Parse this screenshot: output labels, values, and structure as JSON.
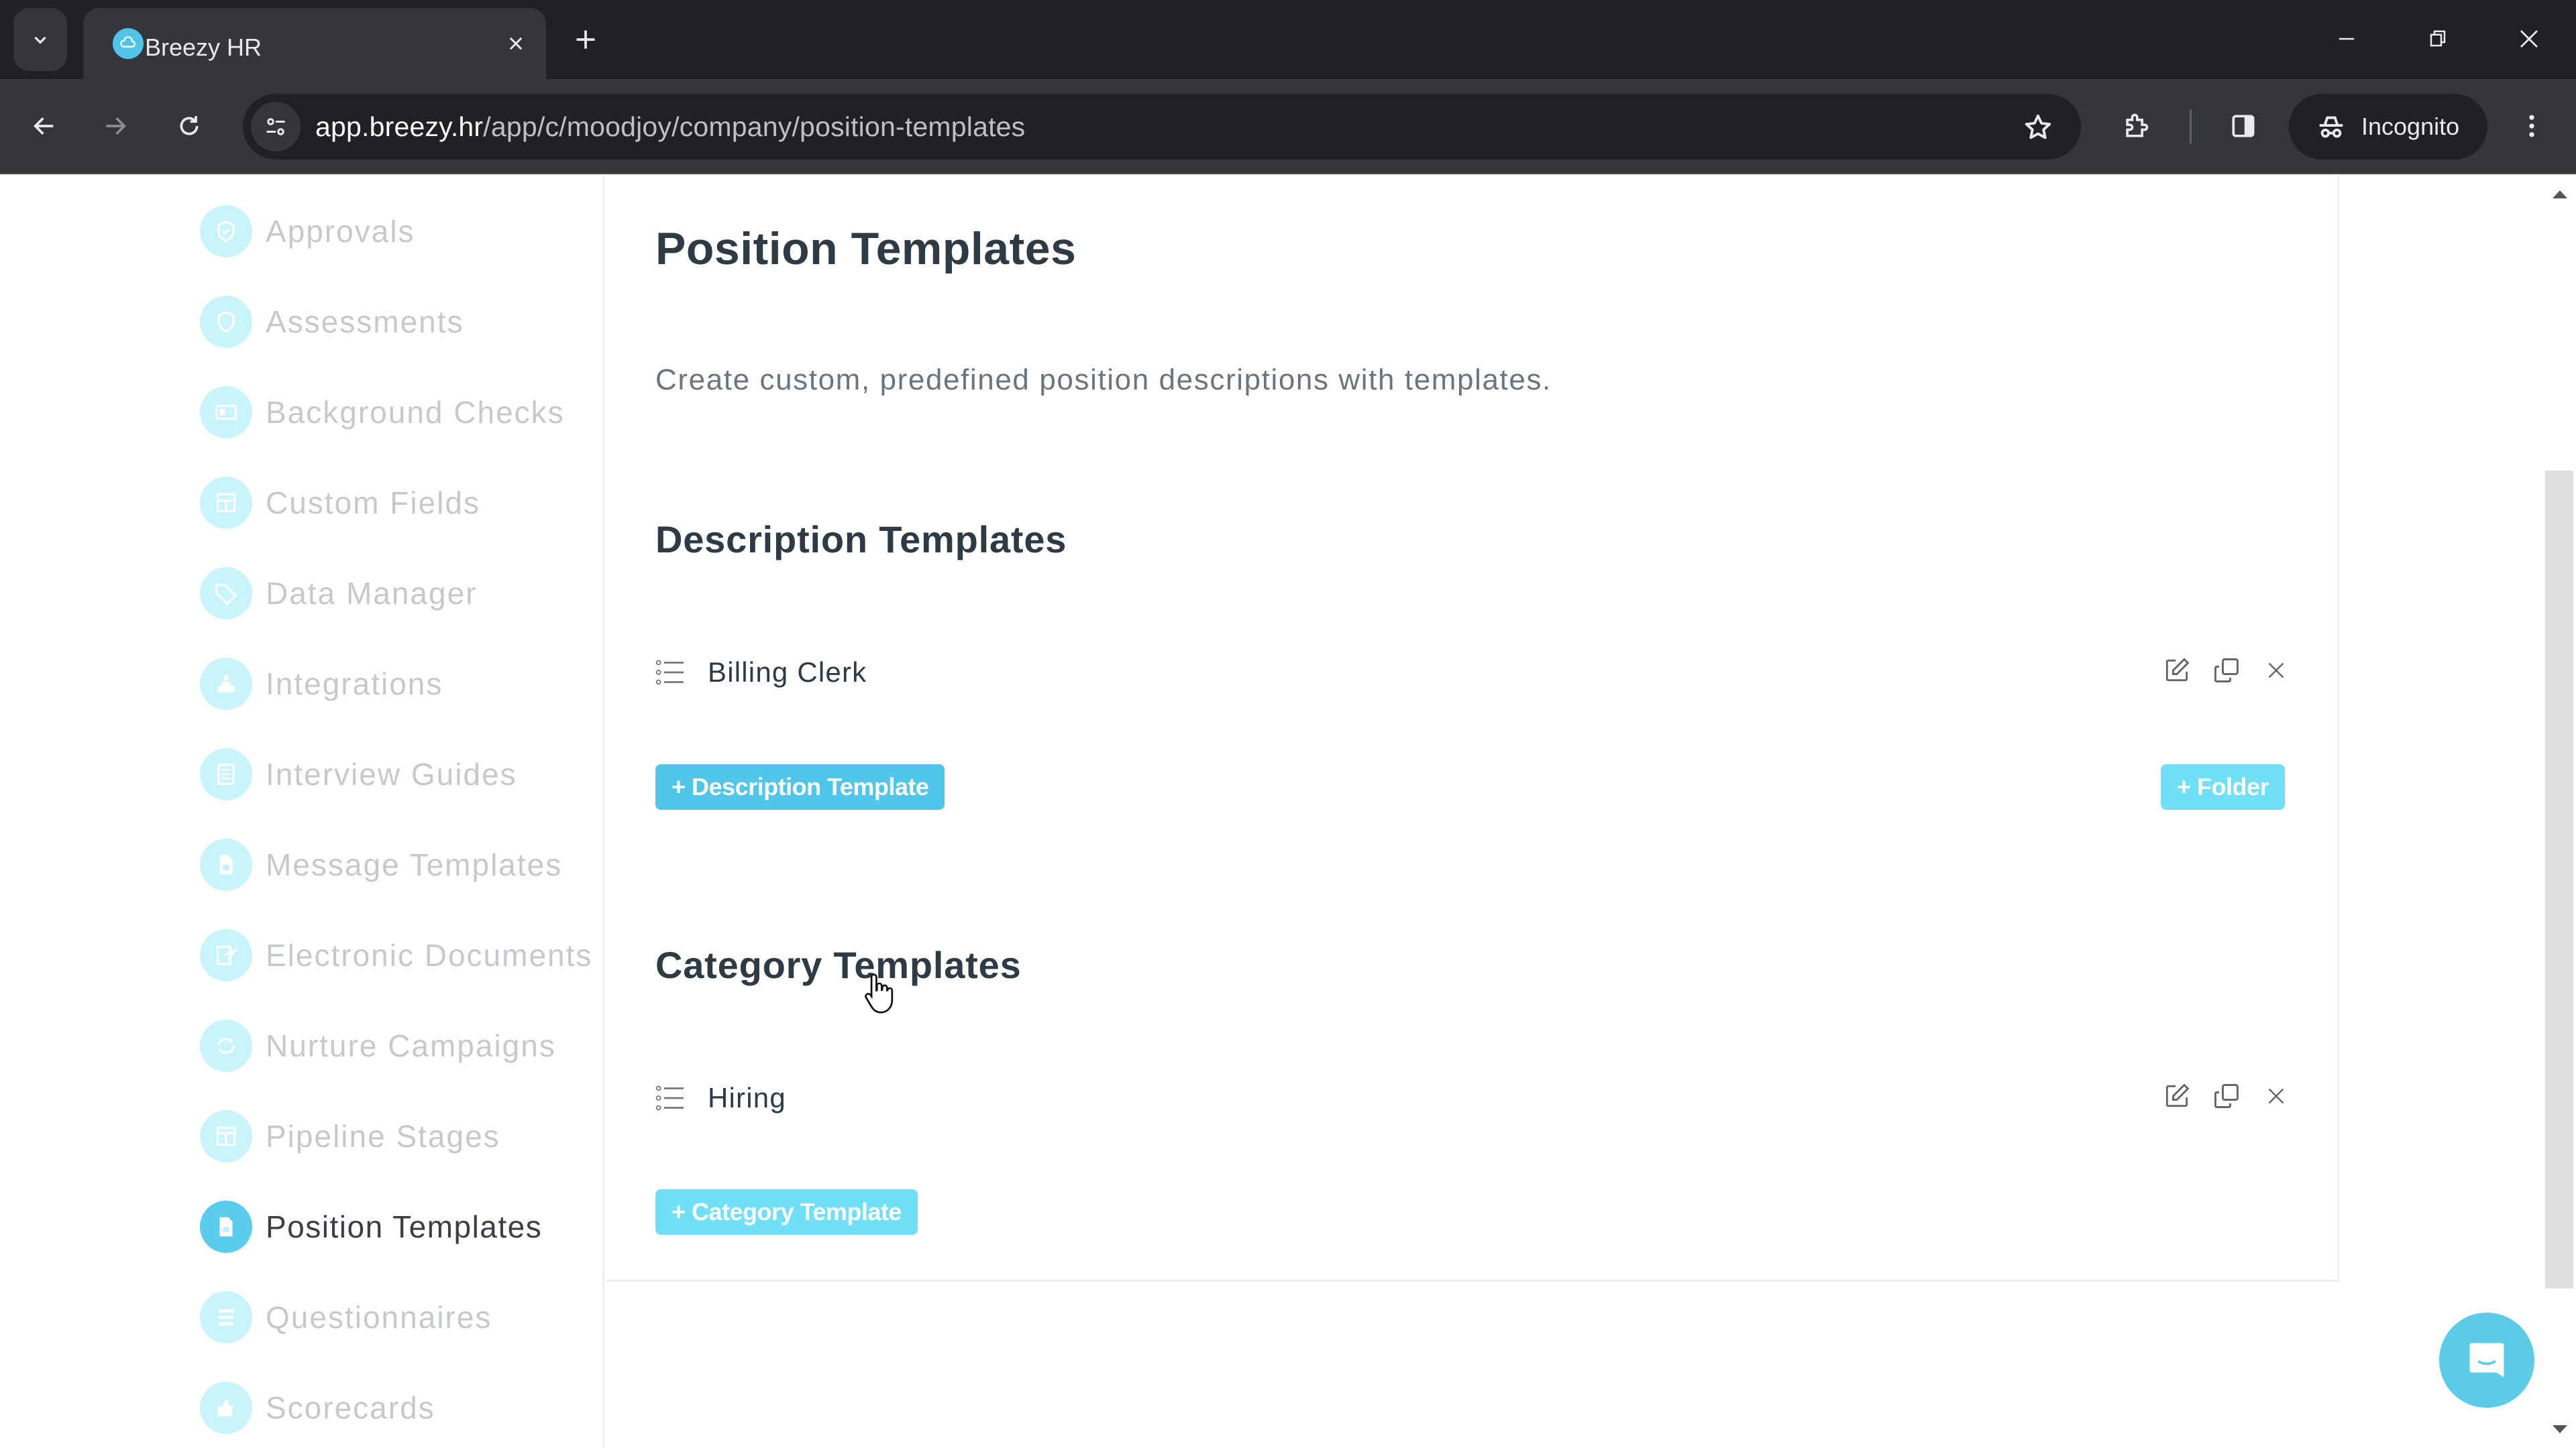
{
  "browser": {
    "tab_title": "Breezy HR",
    "url_host": "app.breezy.hr",
    "url_path": "/app/c/moodjoy/company/position-templates",
    "profile_label": "Incognito"
  },
  "sidebar": {
    "items": [
      {
        "label": "Approvals",
        "icon": "shield-check-icon",
        "active": false
      },
      {
        "label": "Assessments",
        "icon": "shield-icon",
        "active": false
      },
      {
        "label": "Background Checks",
        "icon": "id-card-icon",
        "active": false
      },
      {
        "label": "Custom Fields",
        "icon": "table-icon",
        "active": false
      },
      {
        "label": "Data Manager",
        "icon": "tag-icon",
        "active": false
      },
      {
        "label": "Integrations",
        "icon": "puzzle-icon",
        "active": false
      },
      {
        "label": "Interview Guides",
        "icon": "document-icon",
        "active": false
      },
      {
        "label": "Message Templates",
        "icon": "file-icon",
        "active": false
      },
      {
        "label": "Electronic Documents",
        "icon": "signature-icon",
        "active": false
      },
      {
        "label": "Nurture Campaigns",
        "icon": "refresh-icon",
        "active": false
      },
      {
        "label": "Pipeline Stages",
        "icon": "columns-icon",
        "active": false
      },
      {
        "label": "Position Templates",
        "icon": "file-icon",
        "active": true
      },
      {
        "label": "Questionnaires",
        "icon": "list-icon",
        "active": false
      },
      {
        "label": "Scorecards",
        "icon": "thumbs-up-icon",
        "active": false
      }
    ]
  },
  "main": {
    "title": "Position Templates",
    "description": "Create custom, predefined position descriptions with templates.",
    "description_section": {
      "title": "Description Templates",
      "templates": [
        {
          "name": "Billing Clerk"
        }
      ],
      "add_button": "+ Description Template",
      "folder_button": "+ Folder"
    },
    "category_section": {
      "title": "Category Templates",
      "templates": [
        {
          "name": "Hiring"
        }
      ],
      "add_button": "+ Category Template"
    }
  },
  "colors": {
    "accent": "#4fc6ea",
    "accent_light": "#6fe0f8",
    "sidebar_icon_inactive": "#c9f4fb",
    "text_dark": "#2e3a44",
    "text_muted": "#6c757d"
  }
}
